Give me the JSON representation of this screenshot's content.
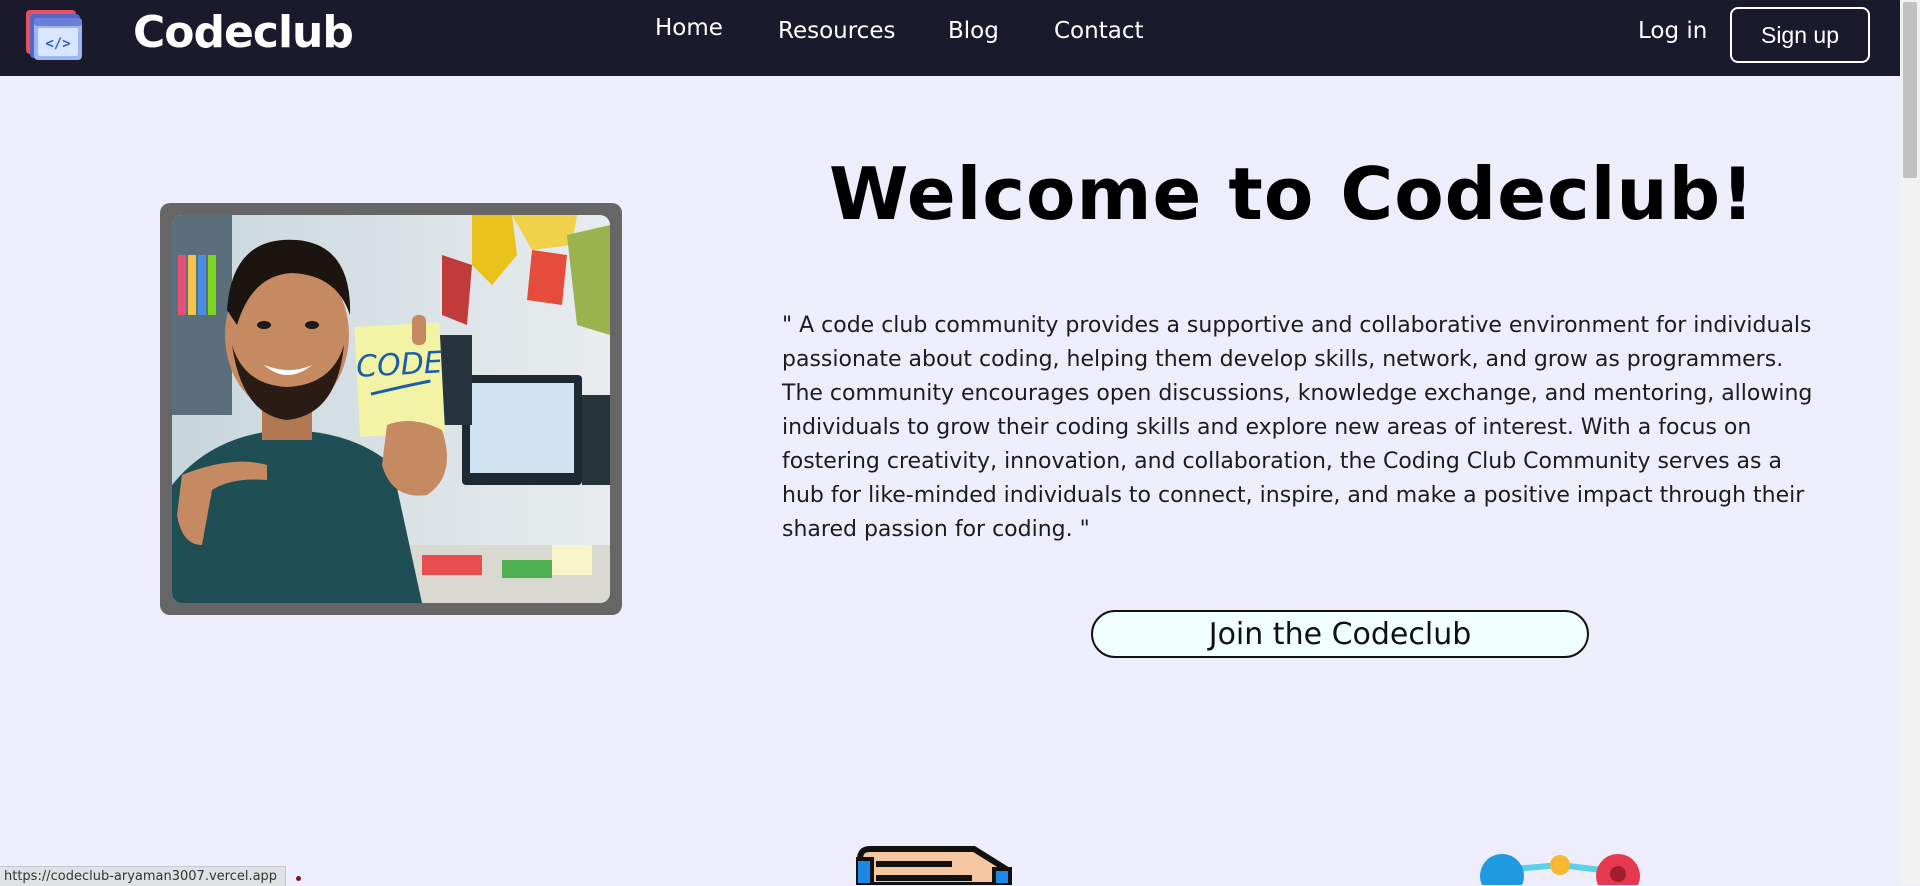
{
  "nav": {
    "brand": "Codeclub",
    "links": [
      "Home",
      "Resources",
      "Blog",
      "Contact"
    ],
    "login": "Log in",
    "signup": "Sign up",
    "logo_icon": "code-window-icon"
  },
  "hero": {
    "title": "Welcome to Codeclub!",
    "quote": "\" A code club community provides a supportive and collaborative environment for individuals passionate about coding, helping them develop skills, network, and grow as programmers. The community encourages open discussions, knowledge exchange, and mentoring, allowing individuals to grow their coding skills and explore new areas of interest. With a focus on fostering creativity, innovation, and collaboration, the Coding Club Community serves as a hub for like-minded individuals to connect, inspire, and make a positive impact through their shared passion for coding. \"",
    "join_button": "Join the Codeclub",
    "photo_note_text": "CODE"
  },
  "status_bar": {
    "url": "https://codeclub-aryaman3007.vercel.app"
  },
  "colors": {
    "nav_bg": "#1b1a2c",
    "page_bg": "#eeedfc",
    "button_bg": "#f0fffe"
  }
}
